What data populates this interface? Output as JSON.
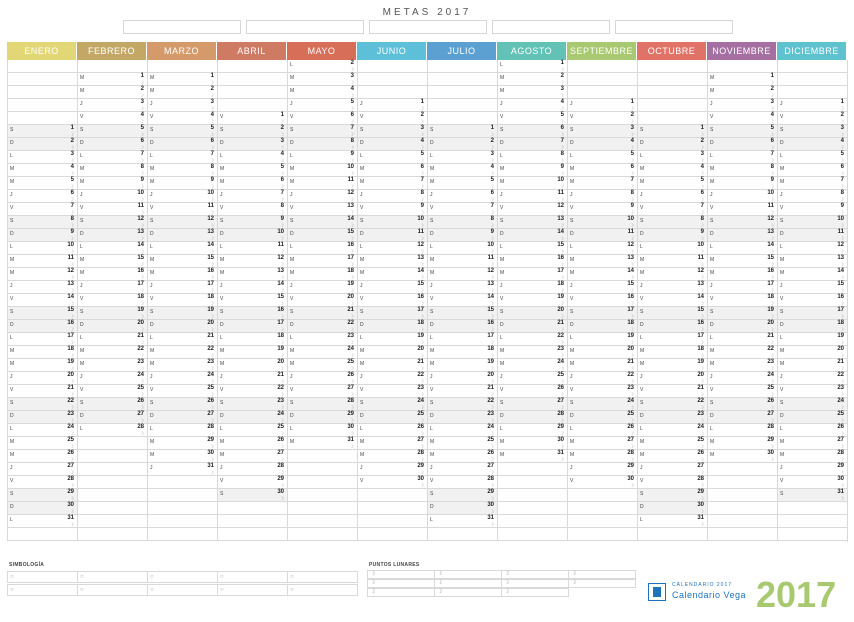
{
  "title": "METAS 2017",
  "goal_boxes": 5,
  "months": [
    {
      "name": "ENERO",
      "color": "#e2d776",
      "offset": 5,
      "days": 31
    },
    {
      "name": "FEBRERO",
      "color": "#c3a865",
      "offset": 1,
      "days": 28
    },
    {
      "name": "MARZO",
      "color": "#d49a6a",
      "offset": 1,
      "days": 31
    },
    {
      "name": "ABRIL",
      "color": "#cf7a63",
      "offset": 4,
      "days": 30
    },
    {
      "name": "MAYO",
      "color": "#d76f58",
      "offset": -1,
      "days": 31
    },
    {
      "name": "JUNIO",
      "color": "#5dc0d8",
      "offset": 3,
      "days": 30
    },
    {
      "name": "JULIO",
      "color": "#5ba0d0",
      "offset": 5,
      "days": 31
    },
    {
      "name": "AGOSTO",
      "color": "#63c2b6",
      "offset": 0,
      "days": 31
    },
    {
      "name": "SEPTIEMBRE",
      "color": "#a8c96f",
      "offset": 3,
      "days": 30
    },
    {
      "name": "OCTUBRE",
      "color": "#e07268",
      "offset": 5,
      "days": 31
    },
    {
      "name": "NOVIEMBRE",
      "color": "#a56fa2",
      "offset": 1,
      "days": 30
    },
    {
      "name": "DICIEMBRE",
      "color": "#5fc3cf",
      "offset": 3,
      "days": 31
    }
  ],
  "weekday_letters": [
    "L",
    "M",
    "M",
    "J",
    "V",
    "S",
    "D"
  ],
  "moon_symbol": "☽",
  "legend": {
    "simbologia_title": "SIMBOLOGÍA",
    "puntos_lunares_title": "PUNTOS LUNARES",
    "circle_symbol": "○"
  },
  "logo": {
    "small_text": "CALENDARIO 2017",
    "brand_text": "Calendario Vega"
  },
  "year": "2017"
}
